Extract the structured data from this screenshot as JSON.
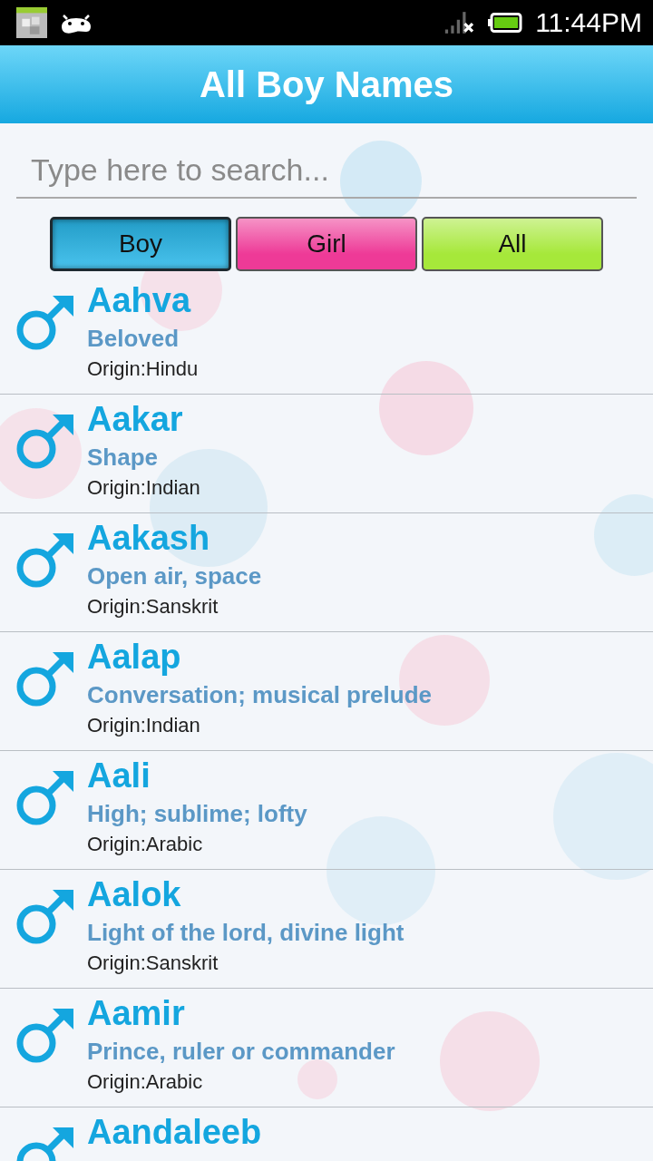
{
  "status_bar": {
    "time": "11:44PM"
  },
  "header": {
    "title": "All Boy Names"
  },
  "search": {
    "placeholder": "Type here to search..."
  },
  "tabs": [
    {
      "label": "Boy",
      "selected": true,
      "color": "#29b8ea"
    },
    {
      "label": "Girl",
      "selected": false,
      "color": "#ee3a97"
    },
    {
      "label": "All",
      "selected": false,
      "color": "#a6e83a"
    }
  ],
  "names": [
    {
      "name": "Aahva",
      "meaning": "Beloved",
      "origin": "Origin:Hindu"
    },
    {
      "name": "Aakar",
      "meaning": "Shape",
      "origin": "Origin:Indian"
    },
    {
      "name": "Aakash",
      "meaning": "Open air, space",
      "origin": "Origin:Sanskrit"
    },
    {
      "name": "Aalap",
      "meaning": "Conversation; musical prelude",
      "origin": "Origin:Indian"
    },
    {
      "name": "Aali",
      "meaning": "High; sublime; lofty",
      "origin": "Origin:Arabic"
    },
    {
      "name": "Aalok",
      "meaning": "Light of the lord, divine light",
      "origin": "Origin:Sanskrit"
    },
    {
      "name": "Aamir",
      "meaning": "Prince, ruler or commander",
      "origin": "Origin:Arabic"
    },
    {
      "name": "Aandaleeb"
    }
  ]
}
